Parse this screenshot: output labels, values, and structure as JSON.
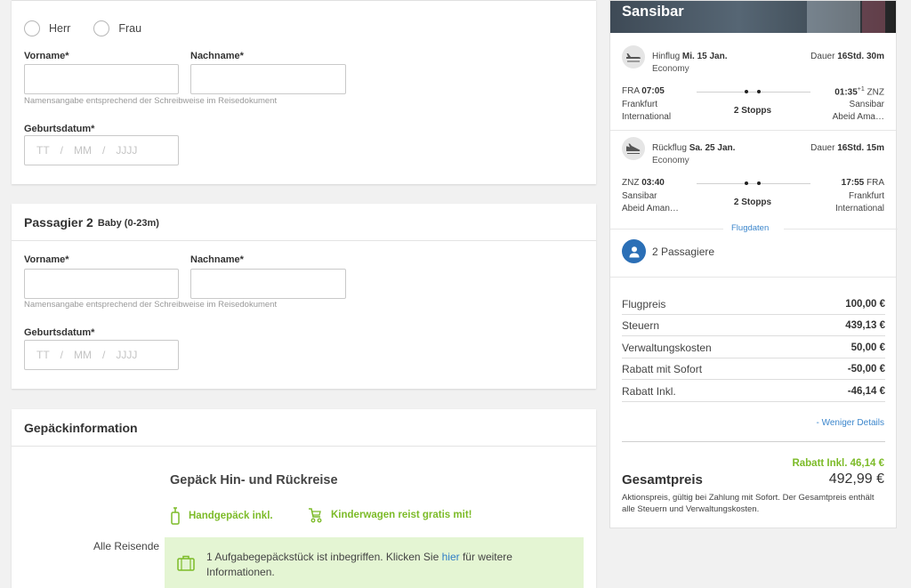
{
  "passenger1": {
    "gender_options": [
      "Herr",
      "Frau"
    ],
    "firstname_label": "Vorname*",
    "lastname_label": "Nachname*",
    "name_hint": "Namensangabe entsprechend der Schreibweise im Reisedokument",
    "dob_label": "Geburtsdatum*",
    "dob_placeholder": {
      "day": "TT",
      "month": "MM",
      "year": "JJJJ",
      "sep": "/"
    }
  },
  "passenger2": {
    "title": "Passagier 2",
    "subtitle": "Baby (0-23m)",
    "firstname_label": "Vorname*",
    "lastname_label": "Nachname*",
    "name_hint": "Namensangabe entsprechend der Schreibweise im Reisedokument",
    "dob_label": "Geburtsdatum*",
    "dob_placeholder": {
      "day": "TT",
      "month": "MM",
      "year": "JJJJ",
      "sep": "/"
    }
  },
  "baggage": {
    "header": "Gepäckinformation",
    "title": "Gepäck Hin- und Rückreise",
    "features": [
      "Handgepäck inkl.",
      "Kinderwagen reist gratis mit!"
    ],
    "all_travelers_label": "Alle Reisende",
    "note_before": "1 Aufgabegepäckstück ist inbegriffen. Klicken Sie ",
    "note_link": "hier",
    "note_after": " für weitere Informationen."
  },
  "summary": {
    "destination": "Sansibar",
    "outbound": {
      "label": "Hinflug",
      "date": "Mi. 15 Jan.",
      "cabin": "Economy",
      "duration_label": "Dauer",
      "duration": "16Std. 30m",
      "dep_code": "FRA",
      "dep_time": "07:05",
      "dep_city": "Frankfurt",
      "dep_airport": "International",
      "arr_time": "01:35",
      "arr_plus": "+1",
      "arr_code": "ZNZ",
      "arr_city": "Sansibar",
      "arr_airport": "Abeid Ama…",
      "stops": "2 Stopps"
    },
    "inbound": {
      "label": "Rückflug",
      "date": "Sa. 25 Jan.",
      "cabin": "Economy",
      "duration_label": "Dauer",
      "duration": "16Std. 15m",
      "dep_code": "ZNZ",
      "dep_time": "03:40",
      "dep_city": "Sansibar",
      "dep_airport": "Abeid Aman…",
      "arr_time": "17:55",
      "arr_code": "FRA",
      "arr_city": "Frankfurt",
      "arr_airport": "International",
      "stops": "2 Stopps"
    },
    "flight_details_link": "Flugdaten",
    "passengers": "2 Passagiere",
    "prices": [
      {
        "label": "Flugpreis",
        "value": "100,00 €"
      },
      {
        "label": "Steuern",
        "value": "439,13 €"
      },
      {
        "label": "Verwaltungskosten",
        "value": "50,00 €"
      },
      {
        "label": "Rabatt mit Sofort",
        "value": "-50,00 €"
      },
      {
        "label": "Rabatt Inkl.",
        "value": "-46,14 €"
      }
    ],
    "less_details_link": "- Weniger Details",
    "discount_note": "Rabatt Inkl. 46,14 €",
    "total_label": "Gesamtpreis",
    "total_value": "492,99 €",
    "total_note": "Aktionspreis, gültig bei Zahlung mit Sofort. Der Gesamtpreis enthält alle Steuern und Verwaltungskosten."
  },
  "colors": {
    "accent_green": "#7cbb28",
    "link_blue": "#3b86cc",
    "avatar_blue": "#2b6fb6",
    "note_bg": "#e4f5d3"
  }
}
